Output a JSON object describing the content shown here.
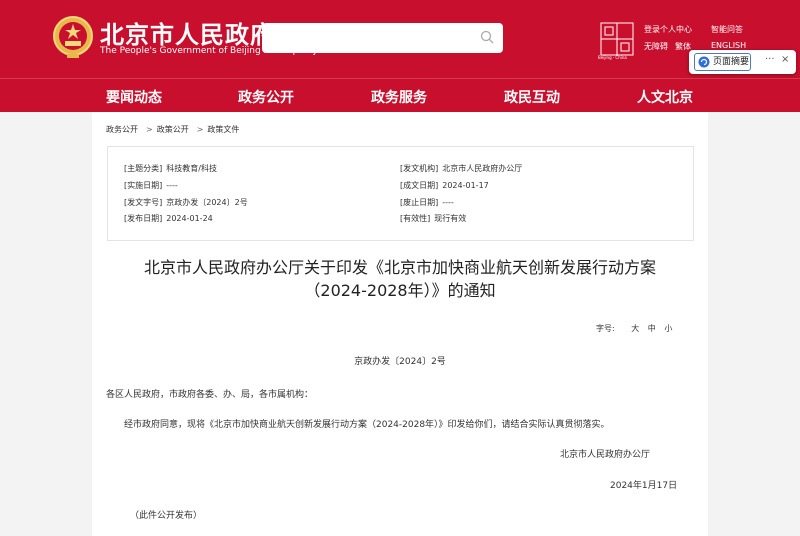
{
  "header": {
    "site_title": "北京市人民政府",
    "site_subtitle": "The People's Government of Beijing Municipality",
    "search_placeholder": "",
    "capital_logo_text": "Beijing · China",
    "links": {
      "login": "登录个人中心",
      "smart_qa": "智能问答",
      "accessibility": "无障碍",
      "traditional": "繁体",
      "english": "ENGLISH"
    },
    "brand_color": "#c8102e"
  },
  "nav": {
    "items": [
      "要闻动态",
      "政务公开",
      "政务服务",
      "政民互动",
      "人文北京"
    ]
  },
  "popup": {
    "summary_label": "页面摘要",
    "more_label": "···",
    "close_label": "×"
  },
  "breadcrumb": [
    "政务公开",
    "政策公开",
    "政策文件"
  ],
  "meta": {
    "left": [
      {
        "key": "[主题分类]",
        "value": "科技教育/科技"
      },
      {
        "key": "[实施日期]",
        "value": "----"
      },
      {
        "key": "[发文字号]",
        "value": "京政办发〔2024〕2号"
      },
      {
        "key": "[发布日期]",
        "value": "2024-01-24"
      }
    ],
    "right": [
      {
        "key": "[发文机构]",
        "value": "北京市人民政府办公厅"
      },
      {
        "key": "[成文日期]",
        "value": "2024-01-17"
      },
      {
        "key": "[废止日期]",
        "value": "----"
      },
      {
        "key": "[有效性]",
        "value": "现行有效"
      }
    ]
  },
  "document": {
    "title_line1": "北京市人民政府办公厅关于印发《北京市加快商业航天创新发展行动方案",
    "title_line2": "（2024-2028年）》的通知",
    "font_size_label": "字号:",
    "font_sizes": [
      "大",
      "中",
      "小"
    ],
    "doc_number": "京政办发〔2024〕2号",
    "salutation": "各区人民政府，市政府各委、办、局，各市属机构：",
    "body": "经市政府同意，现将《北京市加快商业航天创新发展行动方案（2024-2028年）》印发给你们，请结合实际认真贯彻落实。",
    "signature": "北京市人民政府办公厅",
    "date": "2024年1月17日",
    "note": "（此件公开发布）"
  }
}
